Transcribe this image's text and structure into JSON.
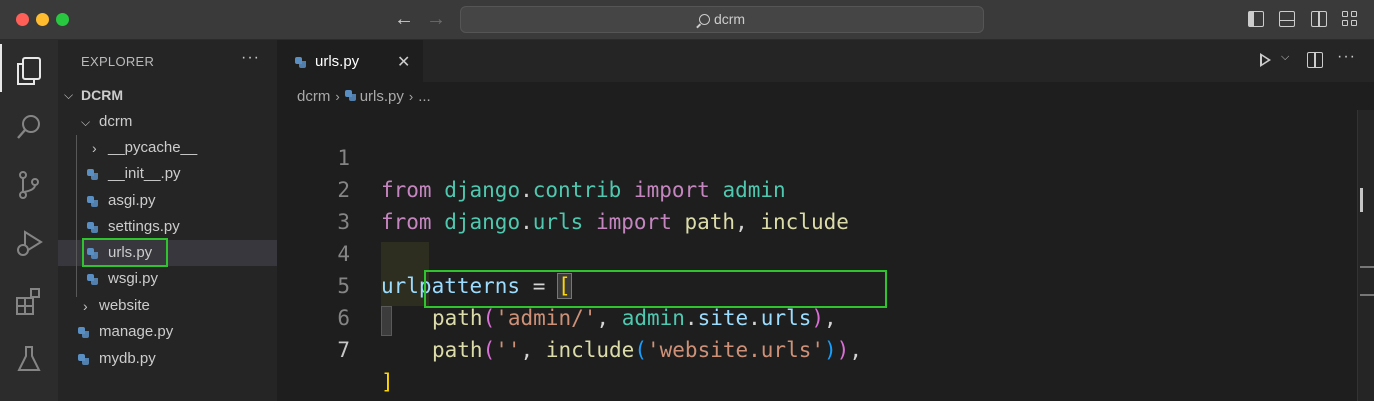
{
  "titlebar": {
    "search_text": "dcrm"
  },
  "activitybar": {
    "items": [
      "explorer-icon",
      "search-icon",
      "source-control-icon",
      "run-debug-icon",
      "extensions-icon",
      "testing-icon"
    ]
  },
  "sidebar": {
    "title": "EXPLORER",
    "more": "···",
    "tree": [
      {
        "label": "DCRM",
        "type": "root"
      },
      {
        "label": "dcrm",
        "type": "folder-open"
      },
      {
        "label": "__pycache__",
        "type": "folder-closed"
      },
      {
        "label": "__init__.py",
        "type": "file"
      },
      {
        "label": "asgi.py",
        "type": "file"
      },
      {
        "label": "settings.py",
        "type": "file"
      },
      {
        "label": "urls.py",
        "type": "file",
        "selected": true
      },
      {
        "label": "wsgi.py",
        "type": "file"
      },
      {
        "label": "website",
        "type": "folder-closed"
      },
      {
        "label": "manage.py",
        "type": "file"
      },
      {
        "label": "mydb.py",
        "type": "file"
      }
    ]
  },
  "editor": {
    "tab_label": "urls.py",
    "tab_close": "✕",
    "more": "···",
    "breadcrumb": {
      "folder": "dcrm",
      "file": "urls.py",
      "symbol": "..."
    },
    "line_numbers": [
      "1",
      "2",
      "3",
      "4",
      "5",
      "6",
      "7"
    ],
    "code": {
      "l1": {
        "t1": "from",
        "t2": "django",
        "t3": ".",
        "t4": "contrib",
        "t5": "import",
        "t6": "admin"
      },
      "l2": {
        "t1": "from",
        "t2": "django",
        "t3": ".",
        "t4": "urls",
        "t5": "import",
        "t6": "path",
        "t7": ", ",
        "t8": "include"
      },
      "l4": {
        "t1": "urlpatterns",
        "t2": " = ",
        "t3": "["
      },
      "l5": {
        "t1": "path",
        "t2": "(",
        "t3": "'admin/'",
        "t4": ", ",
        "t5": "admin",
        "t6": ".",
        "t7": "site",
        "t8": ".",
        "t9": "urls",
        "t10": ")",
        "t11": ","
      },
      "l6": {
        "t1": "path",
        "t2": "(",
        "t3": "''",
        "t4": ", ",
        "t5": "include",
        "t6": "(",
        "t7": "'website.urls'",
        "t8": ")",
        "t9": ")",
        "t10": ","
      },
      "l7": {
        "t1": "]"
      }
    }
  },
  "colors": {
    "highlight_box": "#2fc42f",
    "keyword": "#c586c0",
    "module": "#4ec9b0",
    "variable": "#9cdcfe",
    "function": "#dcdcaa",
    "string": "#ce9178"
  }
}
